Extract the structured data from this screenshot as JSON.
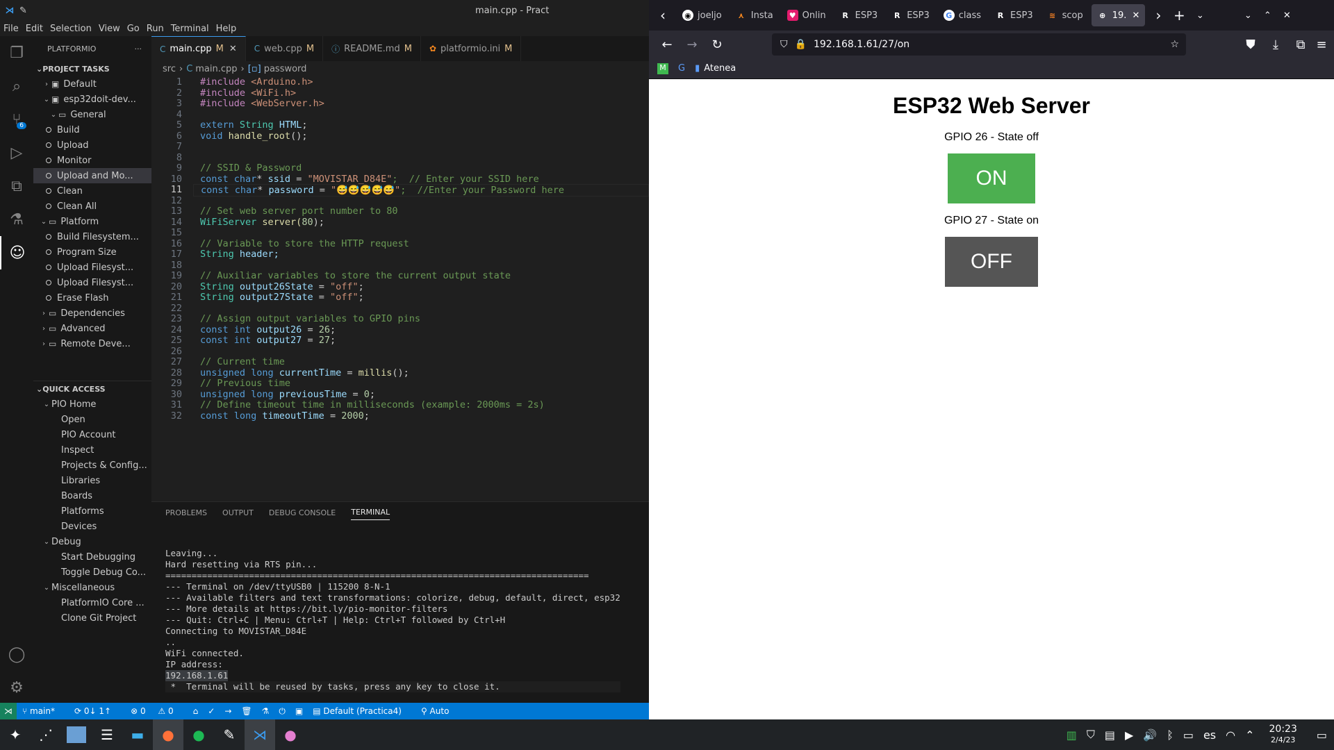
{
  "vscode": {
    "title": "main.cpp - Pract",
    "menu": [
      "File",
      "Edit",
      "Selection",
      "View",
      "Go",
      "Run",
      "Terminal",
      "Help"
    ],
    "scm_badge": "6",
    "sidebar": {
      "title": "PLATFORMIO",
      "project_tasks": "PROJECT TASKS",
      "tasks": [
        "Default",
        "esp32doit-dev...",
        "General",
        "Build",
        "Upload",
        "Monitor",
        "Upload and Mo...",
        "Clean",
        "Clean All",
        "Platform",
        "Build Filesystem...",
        "Program Size",
        "Upload Filesyst...",
        "Upload Filesyst...",
        "Erase Flash",
        "Dependencies",
        "Advanced",
        "Remote Deve..."
      ],
      "quick_access": "QUICK ACCESS",
      "qa": [
        "PIO Home",
        "Open",
        "PIO Account",
        "Inspect",
        "Projects & Config...",
        "Libraries",
        "Boards",
        "Platforms",
        "Devices",
        "Debug",
        "Start Debugging",
        "Toggle Debug Co...",
        "Miscellaneous",
        "PlatformIO Core ...",
        "Clone Git Project"
      ]
    },
    "tabs": [
      {
        "name": "main.cpp",
        "flag": "M"
      },
      {
        "name": "web.cpp",
        "flag": "M"
      },
      {
        "name": "README.md",
        "flag": "M"
      },
      {
        "name": "platformio.ini",
        "flag": "M"
      }
    ],
    "breadcrumb": {
      "folder": "src",
      "file": "main.cpp",
      "symbol": "password"
    },
    "code_lines": [
      "1",
      "2",
      "3",
      "4",
      "5",
      "6",
      "7",
      "8",
      "9",
      "10",
      "11",
      "12",
      "13",
      "14",
      "15",
      "16",
      "17",
      "18",
      "19",
      "20",
      "21",
      "22",
      "23",
      "24",
      "25",
      "26",
      "27",
      "28",
      "29",
      "30",
      "31",
      "32"
    ],
    "code": {
      "l1a": "#include",
      "l1b": " <Arduino.h>",
      "l2a": "#include",
      "l2b": " <WiFi.h>",
      "l3a": "#include",
      "l3b": " <WebServer.h>",
      "l5a": "extern",
      "l5b": " String ",
      "l5c": "HTML",
      ";": ";",
      "l6a": "void",
      "l6b": " handle_root",
      "l9": "// SSID & Password",
      "l10a": "const char",
      "l10b": "* ",
      "l10c": "ssid",
      " =": " = ",
      "l10d": "\"MOVISTAR_D84E\"",
      "l10e": ";  // Enter your SSID here",
      "l11a": "const char",
      "l11c": "password",
      "l11d": "\"",
      "l11e": "\"",
      "l11f": ";  //Enter your Password here",
      "l13": "// Set web server port number to 80",
      "l14a": "WiFiServer",
      "l14b": " server(",
      "l14c": "80",
      "l14d": ");",
      "l16": "// Variable to store the HTTP request",
      "l17a": "String",
      "l17b": " header;",
      "l19": "// Auxiliar variables to store the current output state",
      "l20a": "String",
      "l20b": " output26State",
      "l20c": "\"off\"",
      "l21a": "String",
      "l21b": " output27State",
      "l21c": "\"off\"",
      "l23": "// Assign output variables to GPIO pins",
      "l24a": "const int",
      "l24b": " output26",
      "l24c": "26",
      "l25a": "const int",
      "l25b": " output27",
      "l25c": "27",
      "l27": "// Current time",
      "l28a": "unsigned long",
      "l28b": " currentTime",
      "l28c": "millis",
      "l29": "// Previous time",
      "l30a": "unsigned long",
      "l30b": " previousTime",
      "l30c": "0",
      "l31": "// Define timeout time in milliseconds (example: 2000ms = 2s)",
      "l32a": "const long",
      "l32b": " timeoutTime",
      "l32c": "2000"
    },
    "panel_tabs": [
      "PROBLEMS",
      "OUTPUT",
      "DEBUG CONSOLE",
      "TERMINAL"
    ],
    "terminal": [
      "Leaving...",
      "Hard resetting via RTS pin...",
      "=================================================================================",
      "--- Terminal on /dev/ttyUSB0 | 115200 8-N-1",
      "--- Available filters and text transformations: colorize, debug, default, direct, esp32",
      "--- More details at https://bit.ly/pio-monitor-filters",
      "--- Quit: Ctrl+C | Menu: Ctrl+T | Help: Ctrl+T followed by Ctrl+H",
      "Connecting to MOVISTAR_D84E",
      "..",
      "WiFi connected.",
      "IP address: ",
      "192.168.1.61",
      " *  Terminal will be reused by tasks, press any key to close it."
    ],
    "status": {
      "branch": "main*",
      "sync": "0↓ 1↑",
      "errors": "0",
      "warnings": "0",
      "env": "Default (Practica4)",
      "auto": "Auto"
    }
  },
  "browser": {
    "tabs": [
      "joeljo",
      "Insta",
      "Onlin",
      "ESP3",
      "ESP3",
      "class",
      "ESP3",
      "scop",
      "19."
    ],
    "url": "192.168.1.61/27/on",
    "bookmark": "Atenea",
    "page": {
      "title": "ESP32 Web Server",
      "gpio26": "GPIO 26 - State off",
      "btn_on": "ON",
      "gpio27": "GPIO 27 - State on",
      "btn_off": "OFF",
      "colors": {
        "on": "#4caf50",
        "off": "#555555"
      }
    }
  },
  "taskbar": {
    "lang": "es",
    "time": "20:23",
    "date": "2/4/23"
  }
}
